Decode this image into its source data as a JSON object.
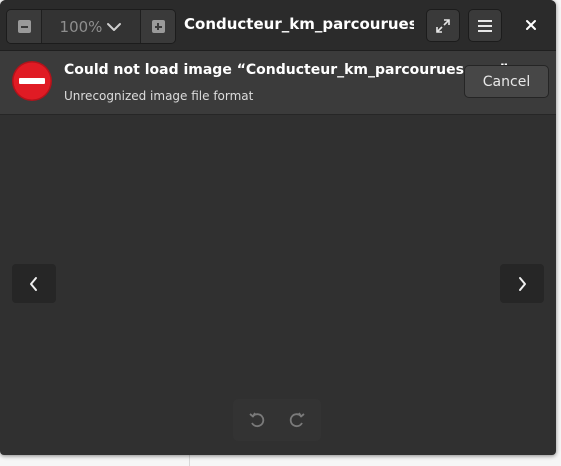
{
  "window": {
    "title": "Conducteur_km_parcourues...."
  },
  "header": {
    "zoom_value": "100%",
    "zoom_out_icon": "zoom-out-icon",
    "zoom_in_icon": "zoom-in-icon",
    "zoom_menu_icon": "chevron-down-icon",
    "fullscreen_icon": "fullscreen-icon",
    "menu_icon": "hamburger-menu-icon",
    "close_icon": "close-icon"
  },
  "infobar": {
    "title": "Could not load image “Conducteur_km_parcourues.png”.",
    "subtitle": "Unrecognized image file format",
    "cancel_label": "Cancel",
    "icon": "error-icon"
  },
  "navigation": {
    "prev_icon": "chevron-left-icon",
    "next_icon": "chevron-right-icon"
  },
  "rotate": {
    "left_icon": "rotate-left-icon",
    "right_icon": "rotate-right-icon"
  },
  "colors": {
    "window_bg": "#303030",
    "headerbar_bg": "#2b2b2b",
    "infobar_bg": "#3b3b3b",
    "error_red": "#e01b24"
  }
}
